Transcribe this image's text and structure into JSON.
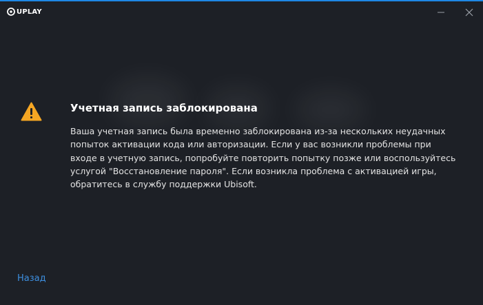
{
  "app": {
    "logo_text": "UPLAY"
  },
  "dialog": {
    "title": "Учетная запись заблокирована",
    "message": "Ваша учетная запись была временно заблокирована из-за нескольких неудачных попыток активации кода или авторизации. Если у вас возникли проблемы при входе в учетную запись, попробуйте повторить попытку позже или воспользуйтесь услугой \"Восстановление пароля\". Если возникла проблема с активацией игры, обратитесь в службу поддержки Ubisoft."
  },
  "footer": {
    "back_label": "Назад"
  },
  "icons": {
    "warning": "warning-icon",
    "minimize": "minimize-icon",
    "close": "close-icon",
    "logo": "uplay-logo-icon"
  },
  "colors": {
    "background": "#1d2026",
    "accent_border": "#1e88e5",
    "warning": "#f5a623",
    "link": "#3d8fe0"
  }
}
